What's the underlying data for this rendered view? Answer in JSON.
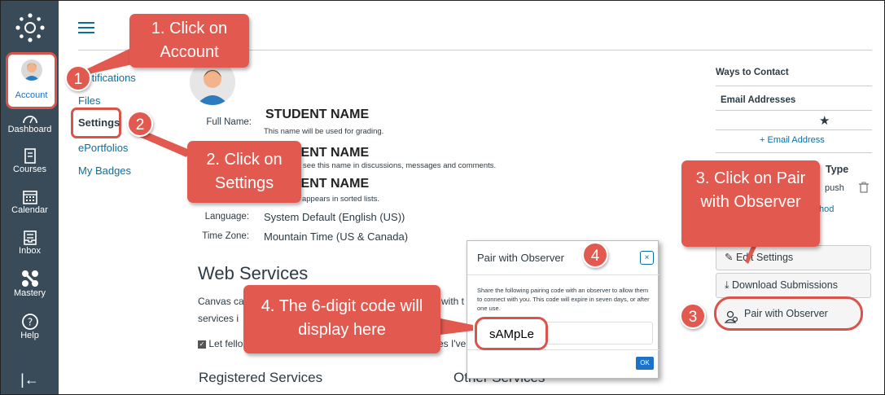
{
  "global_nav": {
    "account": "Account",
    "dashboard": "Dashboard",
    "courses": "Courses",
    "calendar": "Calendar",
    "inbox": "Inbox",
    "mastery": "Mastery",
    "help": "Help",
    "collapse": "|←"
  },
  "account_nav": {
    "notifications": "Notifications",
    "files": "Files",
    "settings": "Settings",
    "eportfolios": "ePortfolios",
    "badges": "My Badges"
  },
  "profile": {
    "full_name_label": "Full Name:",
    "full_name": "STUDENT NAME",
    "full_name_hint": "This name will be used for grading.",
    "display_name": "STUDENT NAME",
    "display_hint": "People will see this name in discussions, messages and comments.",
    "sortable_name": "STUDENT NAME",
    "sortable_hint": "This name appears in sorted lists.",
    "language_label": "Language:",
    "language": "System Default (English (US))",
    "timezone_label": "Time Zone:",
    "timezone": "Mountain Time (US & Canada)"
  },
  "web_services": {
    "title": "Web Services",
    "desc_start": "Canvas ca",
    "desc_mid": "with t",
    "desc_line2": "services i",
    "checkbox": "Let fello",
    "checkbox_end": "es I've",
    "registered": "Registered Services",
    "other": "Other Services"
  },
  "right_panel": {
    "ways": "Ways to Contact",
    "email_header": "Email Addresses",
    "star": "★",
    "add_email": "+ Email Address",
    "type_header": "Type",
    "push": "push",
    "method": "hod",
    "edit_settings": "Edit Settings",
    "download": "Download Submissions",
    "pair": "Pair with Observer"
  },
  "modal": {
    "title": "Pair with Observer",
    "close": "×",
    "desc": "Share the following pairing code with an observer to allow them to connect with you. This code will expire in seven days, or after one use.",
    "code": "sAMpLe",
    "ok": "OK"
  },
  "callouts": {
    "c1": "1. Click on Account",
    "c2": "2. Click on Settings",
    "c3": "3. Click on Pair with Observer",
    "c4": "4. The 6-digit code will display here",
    "n1": "1",
    "n2": "2",
    "n3": "3",
    "n4": "4"
  }
}
